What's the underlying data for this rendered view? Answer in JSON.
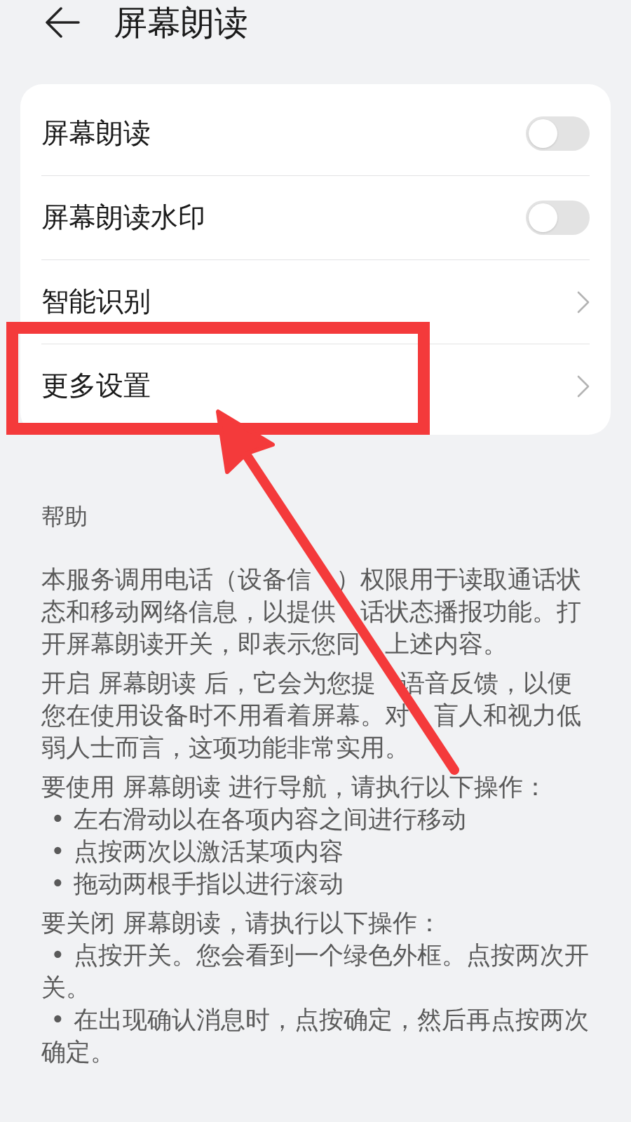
{
  "header": {
    "title": "屏幕朗读"
  },
  "settings": [
    {
      "kind": "toggle",
      "label": "屏幕朗读",
      "on": false,
      "highlighted": false
    },
    {
      "kind": "toggle",
      "label": "屏幕朗读水印",
      "on": false,
      "highlighted": false
    },
    {
      "kind": "link",
      "label": "智能识别",
      "highlighted": false
    },
    {
      "kind": "link",
      "label": "更多设置",
      "highlighted": true
    }
  ],
  "help": {
    "title": "帮助",
    "blocks": [
      {
        "kind": "paragraph",
        "text": "本服务调用电话（设备信　）权限用于读取通话状态和移动网络信息，以提供　话状态播报功能。打开屏幕朗读开关，即表示您同　上述内容。"
      },
      {
        "kind": "paragraph",
        "text": "开启 屏幕朗读 后，它会为您提　语音反馈，以便您在使用设备时不用看着屏幕。对　盲人和视力低弱人士而言，这项功能非常实用。"
      },
      {
        "kind": "list",
        "intro": "要使用 屏幕朗读 进行导航，请执行以下操作：",
        "items": [
          {
            "marker": "•",
            "text": "左右滑动以在各项内容之间进行移动"
          },
          {
            "marker": "•",
            "text": "点按两次以激活某项内容"
          },
          {
            "marker": "•",
            "text": "拖动两根手指以进行滚动"
          }
        ]
      },
      {
        "kind": "list",
        "intro": "要关闭 屏幕朗读，请执行以下操作：",
        "items": [
          {
            "marker": "•",
            "text": "点按开关。您会看到一个绿色外框。点按两次开关。"
          },
          {
            "marker": "•",
            "text": "在出现确认消息时，点按确定，然后再点按两次确定。"
          }
        ]
      }
    ]
  }
}
